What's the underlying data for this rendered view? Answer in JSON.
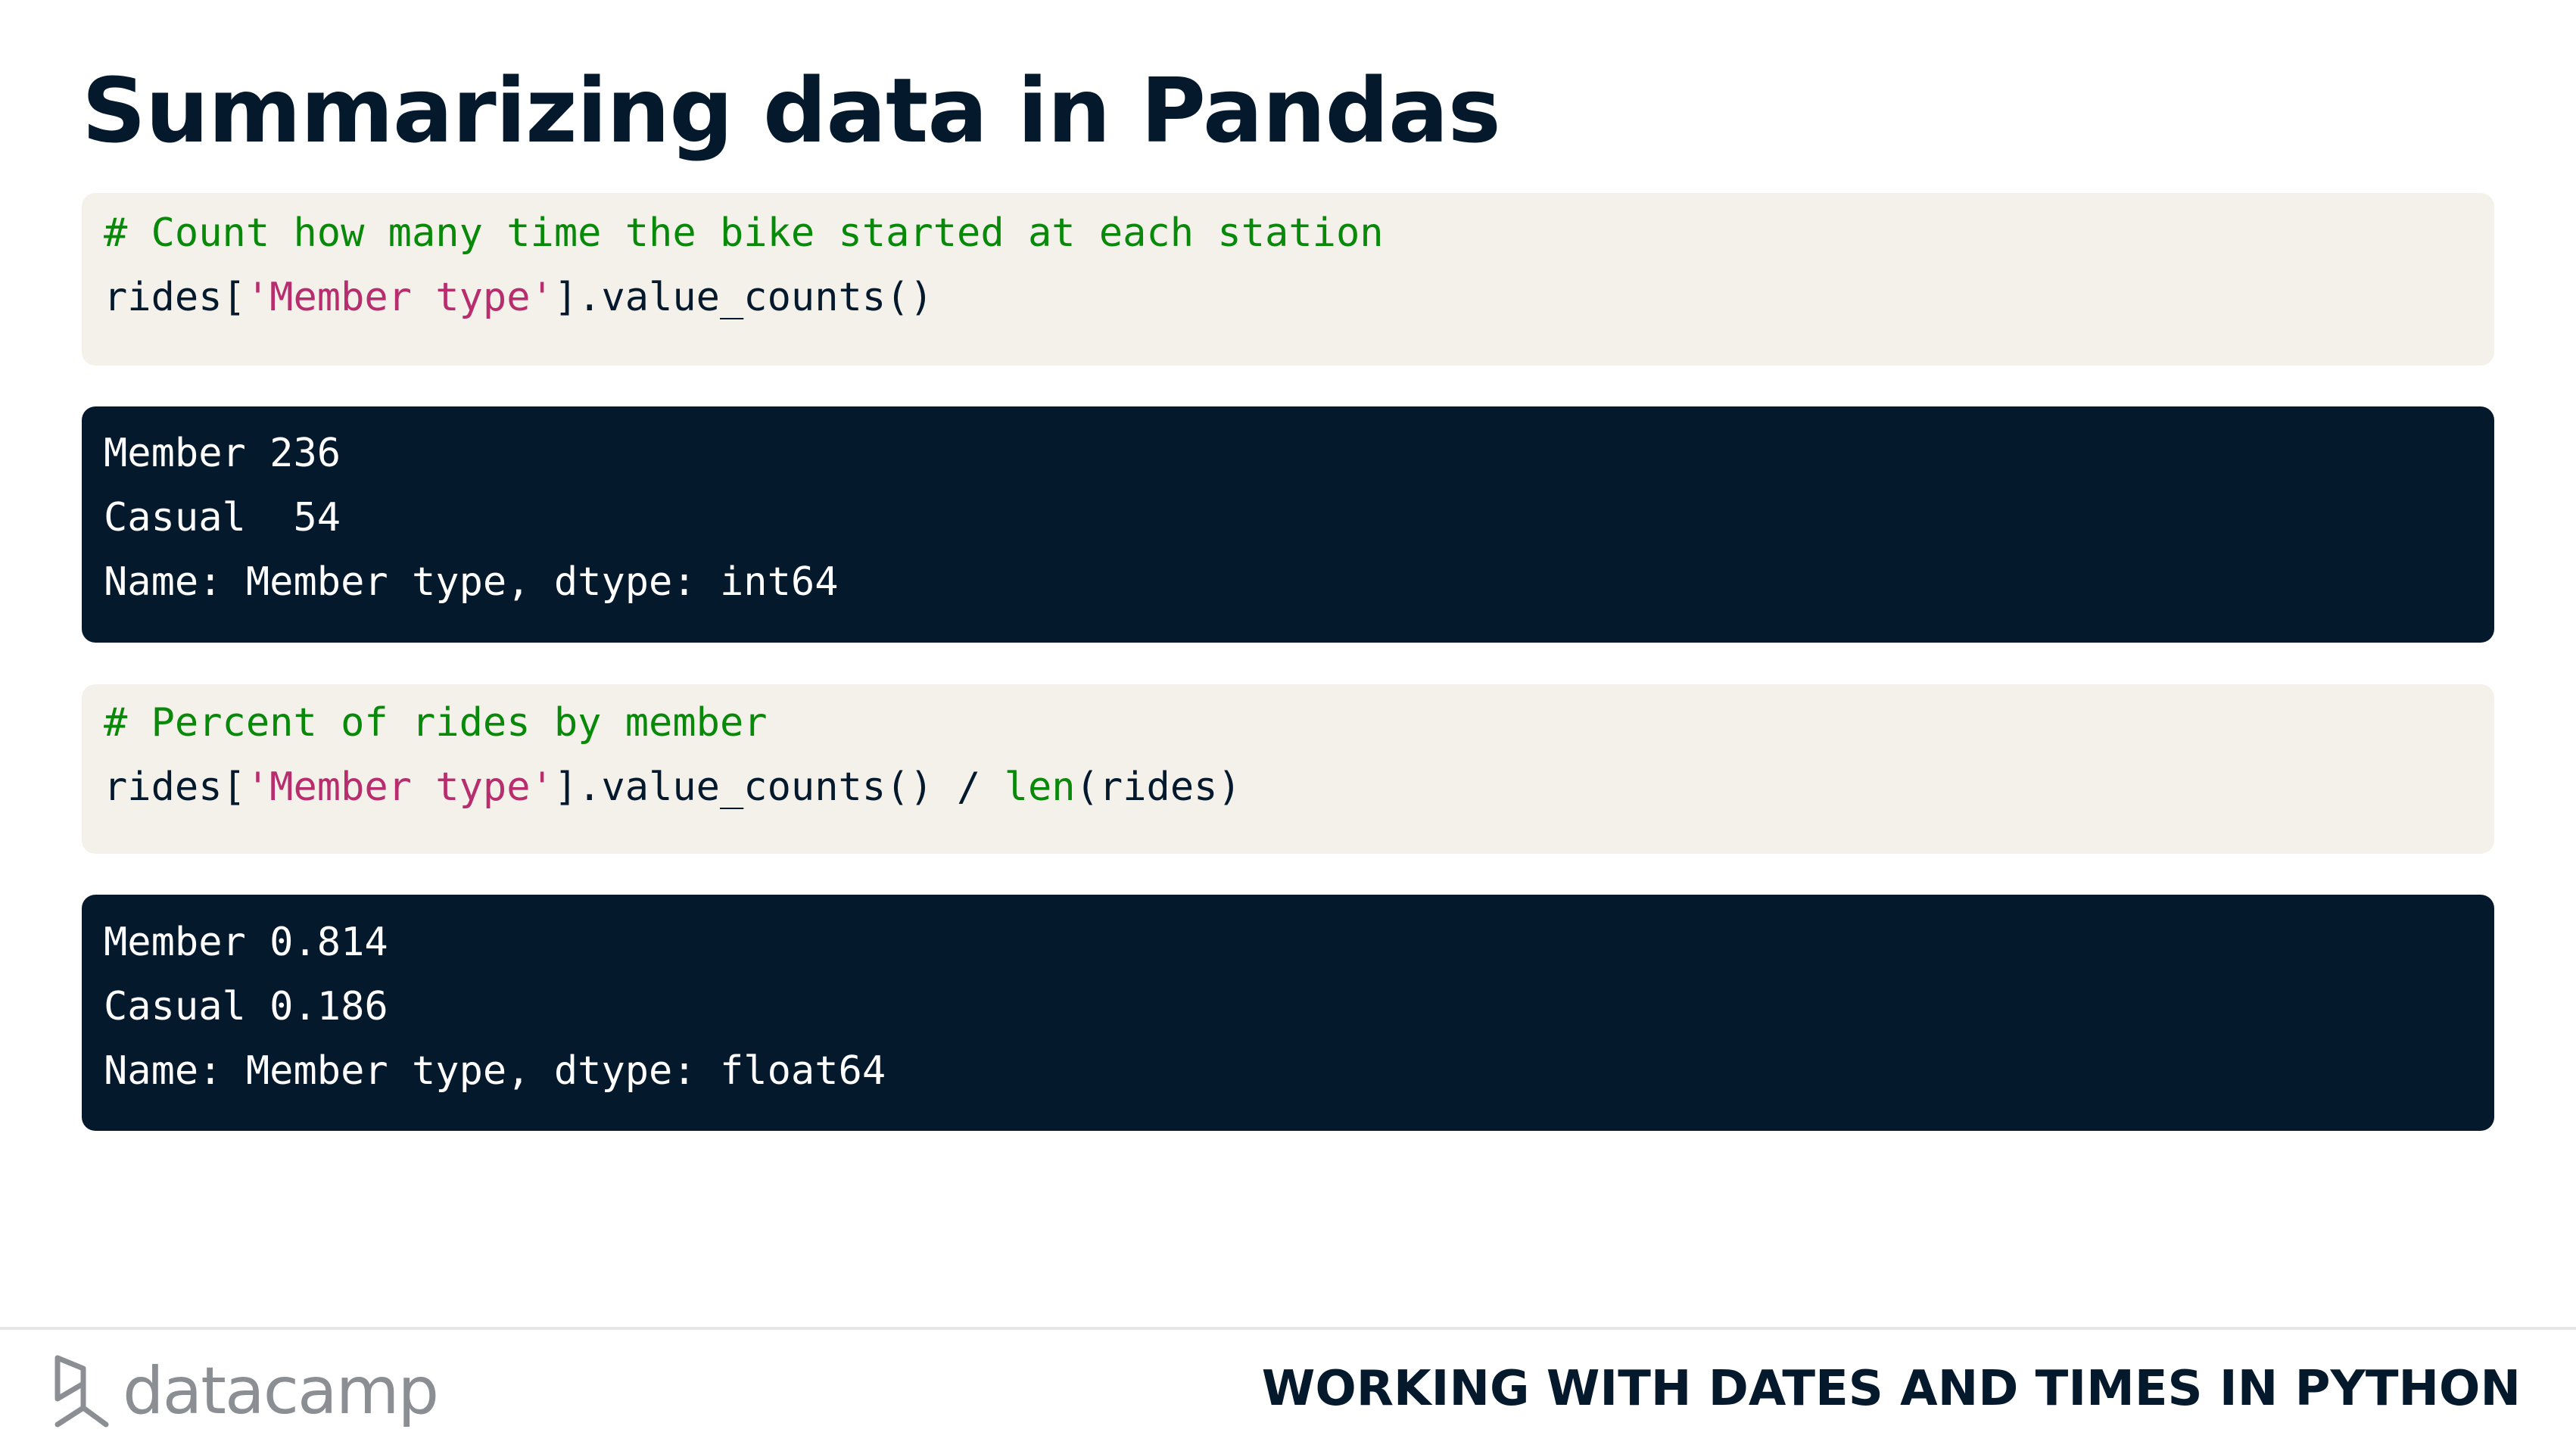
{
  "slide": {
    "title": "Summarizing data in Pandas"
  },
  "code_block_1": {
    "comment": "# Count how many time the bike started at each station",
    "line2_prefix": "rides[",
    "line2_string": "'Member type'",
    "line2_suffix": "].value_counts()"
  },
  "output_block_1": {
    "lines": [
      "Member 236",
      "Casual  54",
      "Name: Member type, dtype: int64"
    ]
  },
  "code_block_2": {
    "comment": "# Percent of rides by member",
    "line2_prefix": "rides[",
    "line2_string": "'Member type'",
    "line2_middle": "].value_counts() / ",
    "line2_builtin": "len",
    "line2_suffix": "(rides)"
  },
  "output_block_2": {
    "lines": [
      "Member 0.814",
      "Casual 0.186",
      "Name: Member type, dtype: float64"
    ]
  },
  "footer": {
    "logo_text": "datacamp",
    "course_title": "WORKING WITH DATES AND TIMES IN PYTHON"
  },
  "colors": {
    "title": "#05192d",
    "code_background": "#f4f1ea",
    "output_background": "#05192d",
    "comment": "#098909",
    "string": "#b72d6d",
    "logo": "#8b8f94"
  }
}
